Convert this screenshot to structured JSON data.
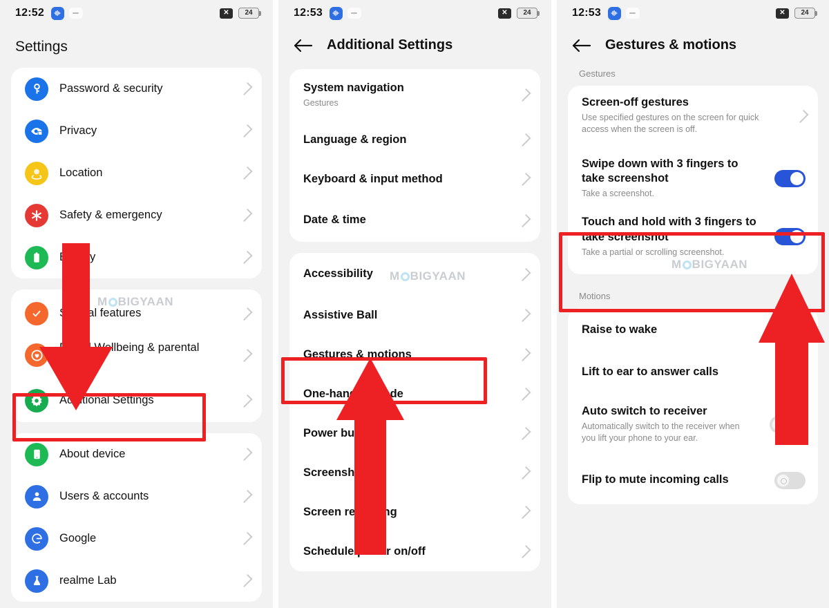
{
  "annotation": {
    "highlight_color": "#ed2024",
    "watermark_text": "MOBIGYAAN",
    "watermark_pre": "M",
    "watermark_post": "BIGYAAN"
  },
  "panels": [
    {
      "id": "settings",
      "statusbar": {
        "time": "12:52",
        "badge_icon": "sound-wave-icon",
        "dash_icon": "dash-icon",
        "mute_icon": "x-icon",
        "battery_level": "24"
      },
      "title": "Settings",
      "groups": [
        {
          "items": [
            {
              "label": "Password & security",
              "icon": "key-icon",
              "icon_color": "#1a73e8"
            },
            {
              "label": "Privacy",
              "icon": "privacy-eye-icon",
              "icon_color": "#1a73e8"
            },
            {
              "label": "Location",
              "icon": "location-pin-icon",
              "icon_color": "#f5c518"
            },
            {
              "label": "Safety & emergency",
              "icon": "emergency-star-icon",
              "icon_color": "#e53935"
            },
            {
              "label": "Battery",
              "icon": "battery-icon",
              "icon_color": "#1db954"
            }
          ]
        },
        {
          "items": [
            {
              "label": "Special features",
              "icon": "special-features-icon",
              "icon_color": "#f4682e"
            },
            {
              "label": "Digital Wellbeing & parental controls",
              "icon": "digital-wellbeing-icon",
              "icon_color": "#f4682e"
            },
            {
              "label": "Additional Settings",
              "icon": "gear-icon",
              "icon_color": "#17ac4f",
              "highlighted": true
            }
          ]
        },
        {
          "items": [
            {
              "label": "About device",
              "icon": "phone-icon",
              "icon_color": "#1db954"
            },
            {
              "label": "Users & accounts",
              "icon": "person-icon",
              "icon_color": "#2f6fe4"
            },
            {
              "label": "Google",
              "icon": "google-icon",
              "icon_color": "#2f6fe4"
            },
            {
              "label": "realme Lab",
              "icon": "lab-flask-icon",
              "icon_color": "#2f6fe4"
            }
          ]
        }
      ]
    },
    {
      "id": "additional-settings",
      "statusbar": {
        "time": "12:53",
        "badge_icon": "sound-wave-icon",
        "dash_icon": "dash-icon",
        "mute_icon": "x-icon",
        "battery_level": "24"
      },
      "title": "Additional Settings",
      "back_icon": "back-arrow-icon",
      "groups": [
        {
          "items": [
            {
              "label": "System navigation",
              "sub": "Gestures"
            },
            {
              "label": "Language & region"
            },
            {
              "label": "Keyboard & input method"
            },
            {
              "label": "Date & time"
            }
          ]
        },
        {
          "items": [
            {
              "label": "Accessibility"
            },
            {
              "label": "Assistive Ball"
            },
            {
              "label": "Gestures & motions",
              "highlighted": true
            },
            {
              "label": "One-handed mode"
            },
            {
              "label": "Power button"
            },
            {
              "label": "Screenshot"
            },
            {
              "label": "Screen recording"
            },
            {
              "label": "Schedule power on/off"
            }
          ]
        }
      ]
    },
    {
      "id": "gestures-motions",
      "statusbar": {
        "time": "12:53",
        "badge_icon": "sound-wave-icon",
        "dash_icon": "dash-icon",
        "mute_icon": "x-icon",
        "battery_level": "24"
      },
      "title": "Gestures & motions",
      "back_icon": "back-arrow-icon",
      "sections": [
        {
          "label": "Gestures",
          "items": [
            {
              "label": "Screen-off gestures",
              "sub": "Use specified gestures on the screen for quick access when the screen is off.",
              "control": "chevron"
            },
            {
              "label": "Swipe down with 3 fingers to take screenshot",
              "sub": "Take a screenshot.",
              "control": "toggle",
              "toggle_state": "on"
            },
            {
              "label": "Touch and hold with 3 fingers to take screenshot",
              "sub": "Take a partial or scrolling screenshot.",
              "control": "toggle",
              "toggle_state": "on",
              "highlighted": true
            }
          ]
        },
        {
          "label": "Motions",
          "items": [
            {
              "label": "Raise to wake",
              "control": "none"
            },
            {
              "label": "Lift to ear to answer calls",
              "control": "none"
            },
            {
              "label": "Auto switch to receiver",
              "sub": "Automatically switch to the receiver when you lift your phone to your ear.",
              "control": "toggle",
              "toggle_state": "off"
            },
            {
              "label": "Flip to mute incoming calls",
              "control": "toggle",
              "toggle_state": "off"
            }
          ]
        }
      ]
    }
  ]
}
